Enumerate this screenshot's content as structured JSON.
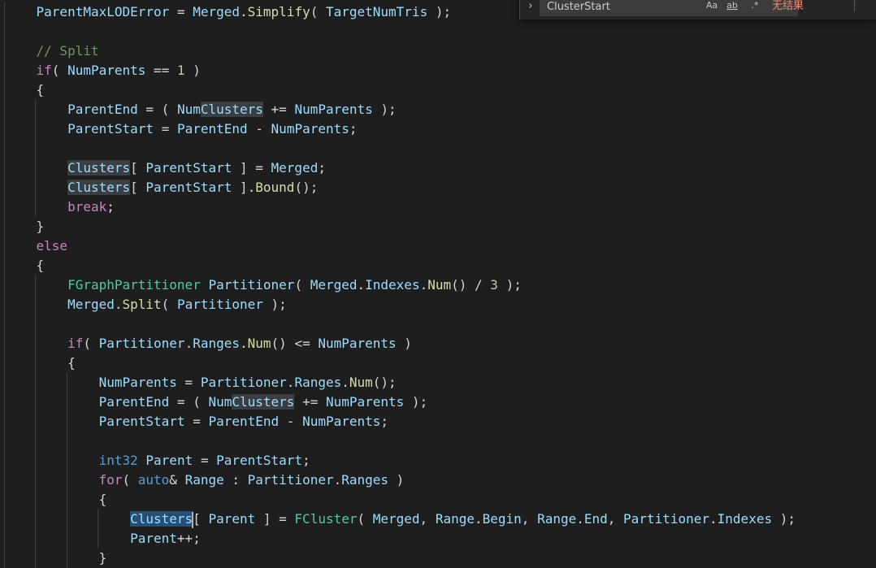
{
  "find_widget": {
    "query": "ClusterStart",
    "match_case_label": "Aa",
    "whole_word_label": "ab",
    "regex_label": ".*",
    "result_text": "无结果",
    "toggle_icon": "chevron-right-icon"
  },
  "colors": {
    "background": "#1e1e1e",
    "variable": "#9cdcfe",
    "function": "#dcdcaa",
    "keyword": "#c586c0",
    "type": "#4ec9b0",
    "storage": "#569cd6",
    "number": "#b5cea8",
    "comment": "#6a9955",
    "match_highlight": "#3a3d41",
    "selection_highlight": "#264f78",
    "no_results": "#f48771"
  },
  "code_lines": [
    {
      "indent": 1,
      "tokens": [
        {
          "t": "ParentMaxLODError",
          "c": "variable"
        },
        {
          "t": " = ",
          "c": "default"
        },
        {
          "t": "Merged",
          "c": "variable"
        },
        {
          "t": ".",
          "c": "default"
        },
        {
          "t": "Simplify",
          "c": "function"
        },
        {
          "t": "( ",
          "c": "default"
        },
        {
          "t": "TargetNumTris",
          "c": "variable"
        },
        {
          "t": " );",
          "c": "default"
        }
      ]
    },
    {
      "indent": 0,
      "tokens": []
    },
    {
      "indent": 1,
      "tokens": [
        {
          "t": "// Split",
          "c": "comment"
        }
      ]
    },
    {
      "indent": 1,
      "tokens": [
        {
          "t": "if",
          "c": "keyword"
        },
        {
          "t": "( ",
          "c": "default"
        },
        {
          "t": "NumParents",
          "c": "variable"
        },
        {
          "t": " == ",
          "c": "default"
        },
        {
          "t": "1",
          "c": "number"
        },
        {
          "t": " )",
          "c": "default"
        }
      ]
    },
    {
      "indent": 1,
      "tokens": [
        {
          "t": "{",
          "c": "default"
        }
      ]
    },
    {
      "indent": 2,
      "tokens": [
        {
          "t": "ParentEnd",
          "c": "variable"
        },
        {
          "t": " = ( ",
          "c": "default"
        },
        {
          "t": "Num",
          "c": "variable"
        },
        {
          "t": "Clusters",
          "c": "variable",
          "hl": "match"
        },
        {
          "t": " += ",
          "c": "default"
        },
        {
          "t": "NumParents",
          "c": "variable"
        },
        {
          "t": " );",
          "c": "default"
        }
      ]
    },
    {
      "indent": 2,
      "tokens": [
        {
          "t": "ParentStart",
          "c": "variable"
        },
        {
          "t": " = ",
          "c": "default"
        },
        {
          "t": "ParentEnd",
          "c": "variable"
        },
        {
          "t": " - ",
          "c": "default"
        },
        {
          "t": "NumParents",
          "c": "variable"
        },
        {
          "t": ";",
          "c": "default"
        }
      ]
    },
    {
      "indent": 0,
      "tokens": []
    },
    {
      "indent": 2,
      "tokens": [
        {
          "t": "Clusters",
          "c": "variable",
          "hl": "match"
        },
        {
          "t": "[ ",
          "c": "default"
        },
        {
          "t": "ParentStart",
          "c": "variable"
        },
        {
          "t": " ] = ",
          "c": "default"
        },
        {
          "t": "Merged",
          "c": "variable"
        },
        {
          "t": ";",
          "c": "default"
        }
      ]
    },
    {
      "indent": 2,
      "tokens": [
        {
          "t": "Clusters",
          "c": "variable",
          "hl": "match"
        },
        {
          "t": "[ ",
          "c": "default"
        },
        {
          "t": "ParentStart",
          "c": "variable"
        },
        {
          "t": " ].",
          "c": "default"
        },
        {
          "t": "Bound",
          "c": "function"
        },
        {
          "t": "();",
          "c": "default"
        }
      ]
    },
    {
      "indent": 2,
      "tokens": [
        {
          "t": "break",
          "c": "control"
        },
        {
          "t": ";",
          "c": "default"
        }
      ]
    },
    {
      "indent": 1,
      "tokens": [
        {
          "t": "}",
          "c": "default"
        }
      ]
    },
    {
      "indent": 1,
      "tokens": [
        {
          "t": "else",
          "c": "keyword"
        }
      ]
    },
    {
      "indent": 1,
      "tokens": [
        {
          "t": "{",
          "c": "default"
        }
      ]
    },
    {
      "indent": 2,
      "tokens": [
        {
          "t": "FGraphPartitioner",
          "c": "type"
        },
        {
          "t": " ",
          "c": "default"
        },
        {
          "t": "Partitioner",
          "c": "variable"
        },
        {
          "t": "( ",
          "c": "default"
        },
        {
          "t": "Merged",
          "c": "variable"
        },
        {
          "t": ".",
          "c": "default"
        },
        {
          "t": "Indexes",
          "c": "variable"
        },
        {
          "t": ".",
          "c": "default"
        },
        {
          "t": "Num",
          "c": "function"
        },
        {
          "t": "() / ",
          "c": "default"
        },
        {
          "t": "3",
          "c": "number"
        },
        {
          "t": " );",
          "c": "default"
        }
      ]
    },
    {
      "indent": 2,
      "tokens": [
        {
          "t": "Merged",
          "c": "variable"
        },
        {
          "t": ".",
          "c": "default"
        },
        {
          "t": "Split",
          "c": "function"
        },
        {
          "t": "( ",
          "c": "default"
        },
        {
          "t": "Partitioner",
          "c": "variable"
        },
        {
          "t": " );",
          "c": "default"
        }
      ]
    },
    {
      "indent": 0,
      "tokens": []
    },
    {
      "indent": 2,
      "tokens": [
        {
          "t": "if",
          "c": "keyword"
        },
        {
          "t": "( ",
          "c": "default"
        },
        {
          "t": "Partitioner",
          "c": "variable"
        },
        {
          "t": ".",
          "c": "default"
        },
        {
          "t": "Ranges",
          "c": "variable"
        },
        {
          "t": ".",
          "c": "default"
        },
        {
          "t": "Num",
          "c": "function"
        },
        {
          "t": "() <= ",
          "c": "default"
        },
        {
          "t": "NumParents",
          "c": "variable"
        },
        {
          "t": " )",
          "c": "default"
        }
      ]
    },
    {
      "indent": 2,
      "tokens": [
        {
          "t": "{",
          "c": "default"
        }
      ]
    },
    {
      "indent": 3,
      "tokens": [
        {
          "t": "NumParents",
          "c": "variable"
        },
        {
          "t": " = ",
          "c": "default"
        },
        {
          "t": "Partitioner",
          "c": "variable"
        },
        {
          "t": ".",
          "c": "default"
        },
        {
          "t": "Ranges",
          "c": "variable"
        },
        {
          "t": ".",
          "c": "default"
        },
        {
          "t": "Num",
          "c": "function"
        },
        {
          "t": "();",
          "c": "default"
        }
      ]
    },
    {
      "indent": 3,
      "tokens": [
        {
          "t": "ParentEnd",
          "c": "variable"
        },
        {
          "t": " = ( ",
          "c": "default"
        },
        {
          "t": "Num",
          "c": "variable"
        },
        {
          "t": "Clusters",
          "c": "variable",
          "hl": "match"
        },
        {
          "t": " += ",
          "c": "default"
        },
        {
          "t": "NumParents",
          "c": "variable"
        },
        {
          "t": " );",
          "c": "default"
        }
      ]
    },
    {
      "indent": 3,
      "tokens": [
        {
          "t": "ParentStart",
          "c": "variable"
        },
        {
          "t": " = ",
          "c": "default"
        },
        {
          "t": "ParentEnd",
          "c": "variable"
        },
        {
          "t": " - ",
          "c": "default"
        },
        {
          "t": "NumParents",
          "c": "variable"
        },
        {
          "t": ";",
          "c": "default"
        }
      ]
    },
    {
      "indent": 0,
      "tokens": []
    },
    {
      "indent": 3,
      "tokens": [
        {
          "t": "int32",
          "c": "storage"
        },
        {
          "t": " ",
          "c": "default"
        },
        {
          "t": "Parent",
          "c": "variable"
        },
        {
          "t": " = ",
          "c": "default"
        },
        {
          "t": "ParentStart",
          "c": "variable"
        },
        {
          "t": ";",
          "c": "default"
        }
      ]
    },
    {
      "indent": 3,
      "tokens": [
        {
          "t": "for",
          "c": "keyword"
        },
        {
          "t": "( ",
          "c": "default"
        },
        {
          "t": "auto",
          "c": "storage"
        },
        {
          "t": "& ",
          "c": "default"
        },
        {
          "t": "Range",
          "c": "variable"
        },
        {
          "t": " : ",
          "c": "default"
        },
        {
          "t": "Partitioner",
          "c": "variable"
        },
        {
          "t": ".",
          "c": "default"
        },
        {
          "t": "Ranges",
          "c": "variable"
        },
        {
          "t": " )",
          "c": "default"
        }
      ]
    },
    {
      "indent": 3,
      "tokens": [
        {
          "t": "{",
          "c": "default"
        }
      ]
    },
    {
      "indent": 4,
      "tokens": [
        {
          "t": "Clusters",
          "c": "variable",
          "hl": "current",
          "cursor": true
        },
        {
          "t": "[ ",
          "c": "default"
        },
        {
          "t": "Parent",
          "c": "variable"
        },
        {
          "t": " ] = ",
          "c": "default"
        },
        {
          "t": "FCluster",
          "c": "type"
        },
        {
          "t": "( ",
          "c": "default"
        },
        {
          "t": "Merged",
          "c": "variable"
        },
        {
          "t": ", ",
          "c": "default"
        },
        {
          "t": "Range",
          "c": "variable"
        },
        {
          "t": ".",
          "c": "default"
        },
        {
          "t": "Begin",
          "c": "variable"
        },
        {
          "t": ", ",
          "c": "default"
        },
        {
          "t": "Range",
          "c": "variable"
        },
        {
          "t": ".",
          "c": "default"
        },
        {
          "t": "End",
          "c": "variable"
        },
        {
          "t": ", ",
          "c": "default"
        },
        {
          "t": "Partitioner",
          "c": "variable"
        },
        {
          "t": ".",
          "c": "default"
        },
        {
          "t": "Indexes",
          "c": "variable"
        },
        {
          "t": " );",
          "c": "default"
        }
      ]
    },
    {
      "indent": 4,
      "tokens": [
        {
          "t": "Parent",
          "c": "variable"
        },
        {
          "t": "++;",
          "c": "default"
        }
      ]
    },
    {
      "indent": 3,
      "tokens": [
        {
          "t": "}",
          "c": "default"
        }
      ]
    }
  ]
}
